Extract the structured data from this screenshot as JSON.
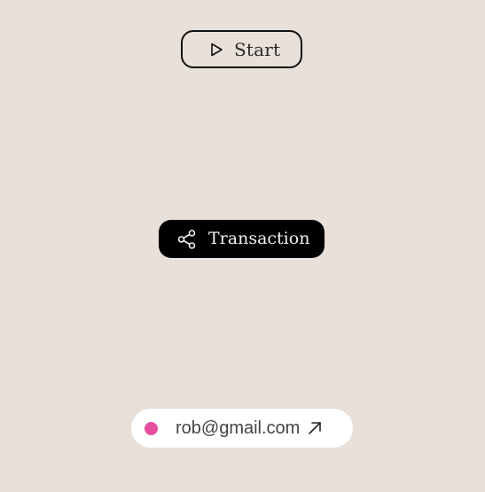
{
  "start_button": {
    "label": "Start",
    "icon": "play-icon"
  },
  "transaction_button": {
    "label": "Transaction",
    "icon": "share-icon"
  },
  "email_pill": {
    "email": "rob@gmail.com",
    "status_color": "#e64f9f",
    "icon": "arrow-up-right-icon"
  },
  "colors": {
    "background": "#e8e0d9",
    "accent": "#e64f9f",
    "dark_button": "#000000"
  }
}
